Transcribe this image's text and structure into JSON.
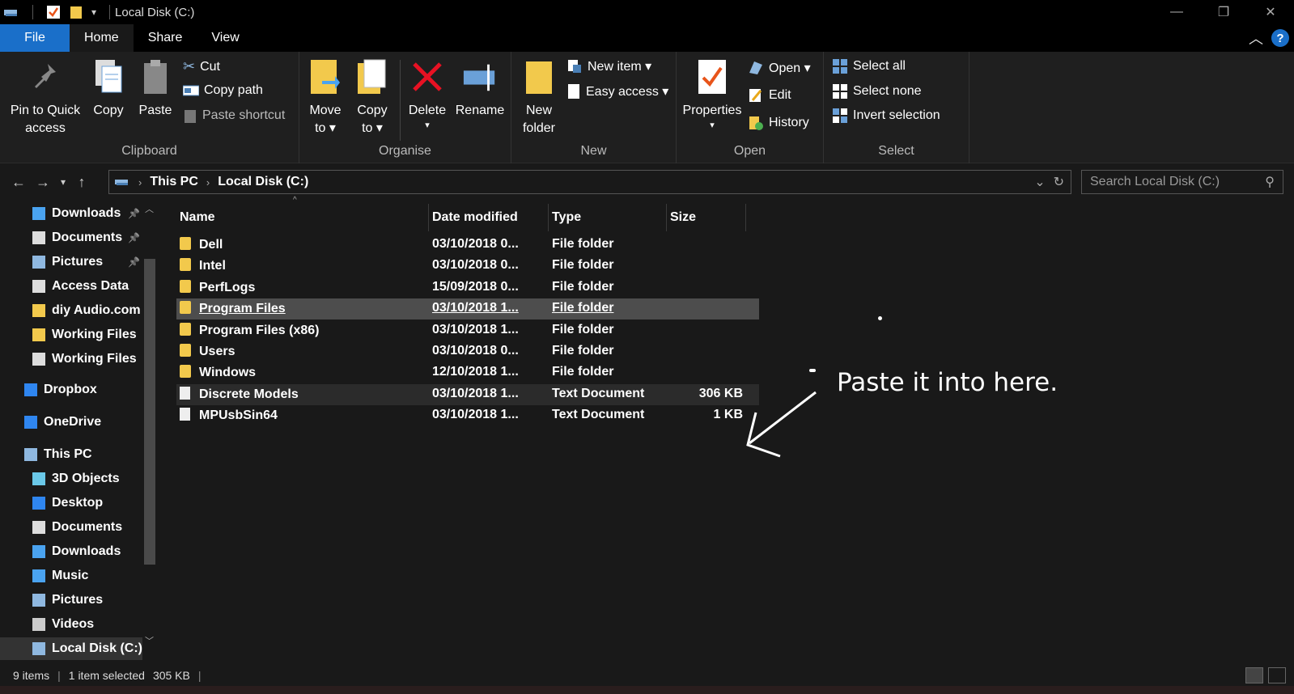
{
  "window": {
    "title": "Local Disk (C:)",
    "minimize": "—",
    "maximize": "❐",
    "close": "✕"
  },
  "tabs": {
    "file": "File",
    "home": "Home",
    "share": "Share",
    "view": "View",
    "help": "?"
  },
  "ribbon": {
    "clipboard": {
      "label": "Clipboard",
      "pin_line1": "Pin to Quick",
      "pin_line2": "access",
      "copy": "Copy",
      "paste": "Paste",
      "cut": "Cut",
      "copy_path": "Copy path",
      "paste_shortcut": "Paste shortcut"
    },
    "organise": {
      "label": "Organise",
      "move_line1": "Move",
      "move_line2": "to ▾",
      "copy_line1": "Copy",
      "copy_line2": "to ▾",
      "delete_line1": "Delete",
      "delete_line2": "▾",
      "rename": "Rename"
    },
    "new": {
      "label": "New",
      "folder_line1": "New",
      "folder_line2": "folder",
      "new_item": "New item ▾",
      "easy_access": "Easy access ▾"
    },
    "open": {
      "label": "Open",
      "properties_line1": "Properties",
      "properties_line2": "▾",
      "open": "Open ▾",
      "edit": "Edit",
      "history": "History"
    },
    "select": {
      "label": "Select",
      "select_all": "Select all",
      "select_none": "Select none",
      "invert": "Invert selection"
    }
  },
  "address": {
    "crumbs": [
      "This PC",
      "Local Disk (C:)"
    ],
    "search_placeholder": "Search Local Disk (C:)"
  },
  "navpane": [
    {
      "label": "Downloads",
      "icon": "download-icon",
      "pinned": true
    },
    {
      "label": "Documents",
      "icon": "document-icon",
      "pinned": true
    },
    {
      "label": "Pictures",
      "icon": "pictures-icon",
      "pinned": true
    },
    {
      "label": "Access Data",
      "icon": "document-icon",
      "pinned": false
    },
    {
      "label": "diy Audio.com",
      "icon": "folder-icon",
      "pinned": false
    },
    {
      "label": "Working Files",
      "icon": "folder-icon",
      "pinned": false
    },
    {
      "label": "Working Files",
      "icon": "document-icon",
      "pinned": false
    },
    {
      "label": "Dropbox",
      "icon": "dropbox-icon",
      "pinned": false
    },
    {
      "label": "OneDrive",
      "icon": "cloud-icon",
      "pinned": false
    },
    {
      "label": "This PC",
      "icon": "computer-icon",
      "pinned": false
    },
    {
      "label": "3D Objects",
      "icon": "cube-icon",
      "pinned": false
    },
    {
      "label": "Desktop",
      "icon": "desktop-icon",
      "pinned": false
    },
    {
      "label": "Documents",
      "icon": "document-icon",
      "pinned": false
    },
    {
      "label": "Downloads",
      "icon": "download-icon",
      "pinned": false
    },
    {
      "label": "Music",
      "icon": "music-icon",
      "pinned": false
    },
    {
      "label": "Pictures",
      "icon": "pictures-icon",
      "pinned": false
    },
    {
      "label": "Videos",
      "icon": "video-icon",
      "pinned": false
    },
    {
      "label": "Local Disk (C:)",
      "icon": "drive-icon",
      "pinned": false
    }
  ],
  "columns": {
    "name": "Name",
    "date": "Date modified",
    "type": "Type",
    "size": "Size"
  },
  "files": [
    {
      "name": "Dell",
      "date": "03/10/2018 0...",
      "type": "File folder",
      "size": "",
      "kind": "folder"
    },
    {
      "name": "Intel",
      "date": "03/10/2018 0...",
      "type": "File folder",
      "size": "",
      "kind": "folder"
    },
    {
      "name": "PerfLogs",
      "date": "15/09/2018 0...",
      "type": "File folder",
      "size": "",
      "kind": "folder"
    },
    {
      "name": "Program Files",
      "date": "03/10/2018 1...",
      "type": "File folder",
      "size": "",
      "kind": "folder"
    },
    {
      "name": "Program Files (x86)",
      "date": "03/10/2018 1...",
      "type": "File folder",
      "size": "",
      "kind": "folder"
    },
    {
      "name": "Users",
      "date": "03/10/2018 0...",
      "type": "File folder",
      "size": "",
      "kind": "folder"
    },
    {
      "name": "Windows",
      "date": "12/10/2018 1...",
      "type": "File folder",
      "size": "",
      "kind": "folder"
    },
    {
      "name": "Discrete Models",
      "date": "03/10/2018 1...",
      "type": "Text Document",
      "size": "306 KB",
      "kind": "doc"
    },
    {
      "name": "MPUsbSin64",
      "date": "03/10/2018 1...",
      "type": "Text Document",
      "size": "1 KB",
      "kind": "doc"
    }
  ],
  "annotation": "Paste it into here.",
  "status": {
    "items": "9 items",
    "selected": "1 item selected",
    "size": "305 KB"
  },
  "colors": {
    "accent": "#1a6fc9",
    "folder": "#f2c94c",
    "delete": "#e81123"
  }
}
